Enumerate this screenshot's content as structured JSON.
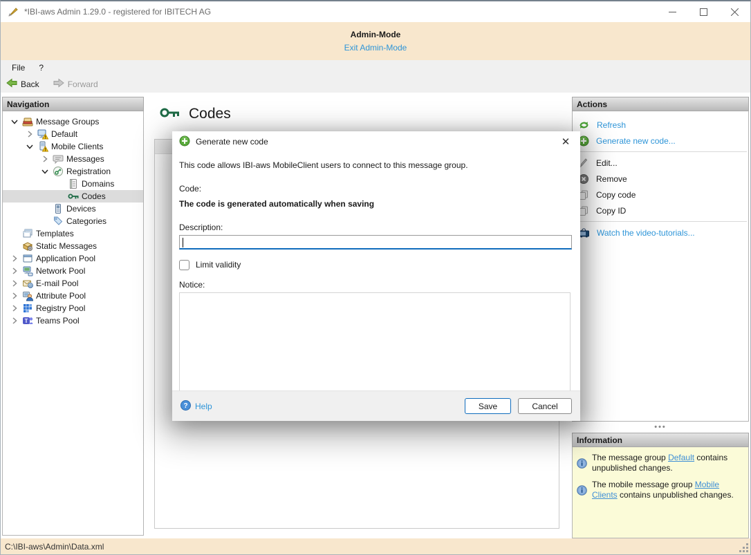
{
  "window": {
    "title": "*IBI-aws Admin 1.29.0 - registered for IBITECH AG",
    "controls": {
      "minimize": "minimize",
      "maximize": "maximize",
      "close": "close"
    }
  },
  "admin_banner": {
    "title": "Admin-Mode",
    "exit_link": "Exit Admin-Mode"
  },
  "menu": {
    "items": [
      "File",
      "?"
    ]
  },
  "toolbar": {
    "back_label": "Back",
    "forward_label": "Forward"
  },
  "navigation": {
    "header": "Navigation",
    "tree": [
      {
        "label": "Message Groups",
        "depth": 0,
        "icon": "message-groups",
        "chevron": "down",
        "selected": false
      },
      {
        "label": "Default",
        "depth": 1,
        "icon": "monitor-warning",
        "chevron": "right",
        "selected": false
      },
      {
        "label": "Mobile Clients",
        "depth": 1,
        "icon": "mobile-warning",
        "chevron": "down",
        "selected": false
      },
      {
        "label": "Messages",
        "depth": 2,
        "icon": "speech-bubble",
        "chevron": "right",
        "selected": false
      },
      {
        "label": "Registration",
        "depth": 2,
        "icon": "key-circle",
        "chevron": "down",
        "selected": false
      },
      {
        "label": "Domains",
        "depth": 3,
        "icon": "document",
        "chevron": null,
        "selected": false
      },
      {
        "label": "Codes",
        "depth": 3,
        "icon": "key",
        "chevron": null,
        "selected": true
      },
      {
        "label": "Devices",
        "depth": 2,
        "icon": "device",
        "chevron": null,
        "selected": false
      },
      {
        "label": "Categories",
        "depth": 2,
        "icon": "tag",
        "chevron": null,
        "selected": false
      },
      {
        "label": "Templates",
        "depth": 0,
        "icon": "templates",
        "chevron": null,
        "selected": false
      },
      {
        "label": "Static Messages",
        "depth": 0,
        "icon": "static-messages",
        "chevron": null,
        "selected": false
      },
      {
        "label": "Application Pool",
        "depth": 0,
        "icon": "application",
        "chevron": "right",
        "selected": false
      },
      {
        "label": "Network Pool",
        "depth": 0,
        "icon": "network",
        "chevron": "right",
        "selected": false
      },
      {
        "label": "E-mail Pool",
        "depth": 0,
        "icon": "email",
        "chevron": "right",
        "selected": false
      },
      {
        "label": "Attribute Pool",
        "depth": 0,
        "icon": "attribute",
        "chevron": "right",
        "selected": false
      },
      {
        "label": "Registry Pool",
        "depth": 0,
        "icon": "registry",
        "chevron": "right",
        "selected": false
      },
      {
        "label": "Teams Pool",
        "depth": 0,
        "icon": "teams",
        "chevron": "right",
        "selected": false
      }
    ]
  },
  "main": {
    "title": "Codes"
  },
  "dialog": {
    "title": "Generate new code",
    "intro": "This code allows IBI-aws MobileClient users to connect to this message group.",
    "code_label": "Code:",
    "code_value": "The code is generated automatically when saving",
    "description_label": "Description:",
    "description_value": "",
    "limit_validity_label": "Limit validity",
    "limit_validity_checked": false,
    "notice_label": "Notice:",
    "notice_value": "",
    "help_label": "Help",
    "save_label": "Save",
    "cancel_label": "Cancel"
  },
  "actions": {
    "header": "Actions",
    "groups": [
      [
        {
          "label": "Refresh",
          "icon": "refresh",
          "link": true
        },
        {
          "label": "Generate new code...",
          "icon": "plus",
          "link": true
        }
      ],
      [
        {
          "label": "Edit...",
          "icon": "pencil",
          "link": false
        },
        {
          "label": "Remove",
          "icon": "remove",
          "link": false
        },
        {
          "label": "Copy code",
          "icon": "copy",
          "link": false
        },
        {
          "label": "Copy ID",
          "icon": "copy",
          "link": false
        }
      ],
      [
        {
          "label": "Watch the video-tutorials...",
          "icon": "tv",
          "link": true
        }
      ]
    ]
  },
  "information": {
    "header": "Information",
    "items": [
      {
        "prefix": "The message group ",
        "link": "Default",
        "suffix": " contains unpublished changes."
      },
      {
        "prefix": "The mobile message group ",
        "link": "Mobile Clients",
        "suffix": " contains unpublished changes."
      }
    ]
  },
  "status_bar": {
    "path": "C:\\IBI-aws\\Admin\\Data.xml"
  },
  "colors": {
    "banner_bg": "#f8e7cd",
    "link_blue": "#2e95d8",
    "info_bg": "#fbfbd8",
    "accent_blue": "#0f6cbd",
    "key_green": "#1e6b46",
    "action_green": "#4ca637"
  }
}
